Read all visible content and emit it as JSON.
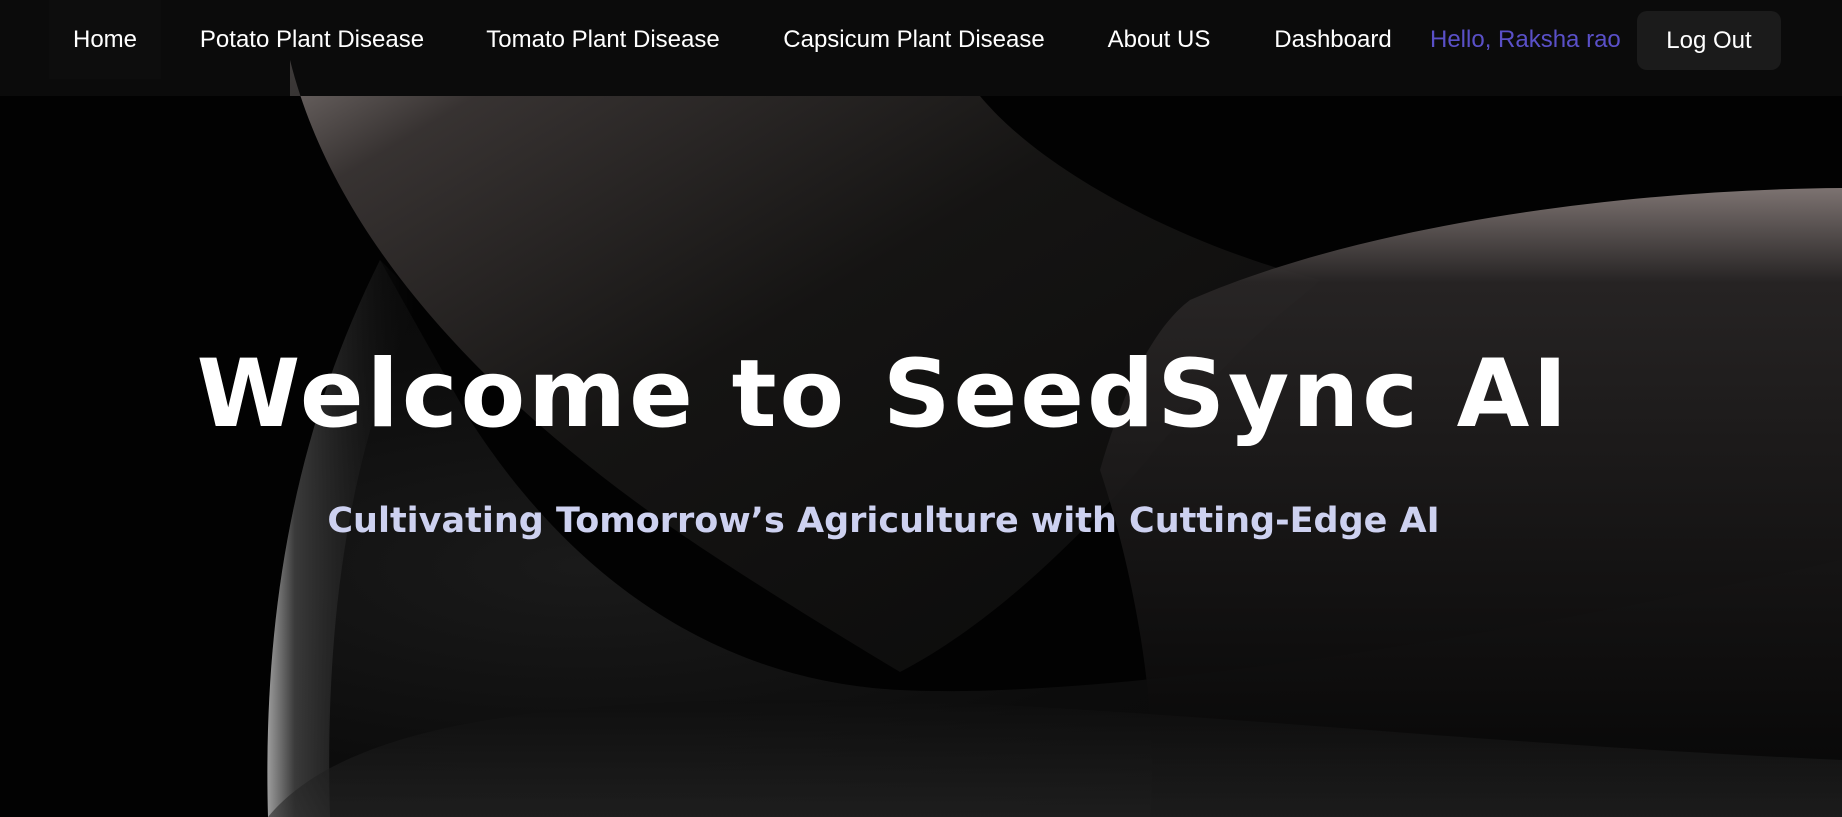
{
  "nav": {
    "items": [
      {
        "label": "Home",
        "active": true
      },
      {
        "label": "Potato Plant Disease"
      },
      {
        "label": "Tomato Plant Disease"
      },
      {
        "label": "Capsicum Plant Disease"
      },
      {
        "label": "About US"
      },
      {
        "label": "Dashboard"
      }
    ],
    "greeting": "Hello, Raksha rao",
    "logout_label": "Log Out"
  },
  "hero": {
    "title": "Welcome to SeedSync AI",
    "subtitle": "Cultivating Tomorrow’s Agriculture with Cutting-Edge AI"
  },
  "colors": {
    "background": "#020202",
    "text": "#ffffff",
    "greeting": "#5a50c8",
    "subtitle": "#cdd1f0",
    "button": "#1b1b1b"
  }
}
